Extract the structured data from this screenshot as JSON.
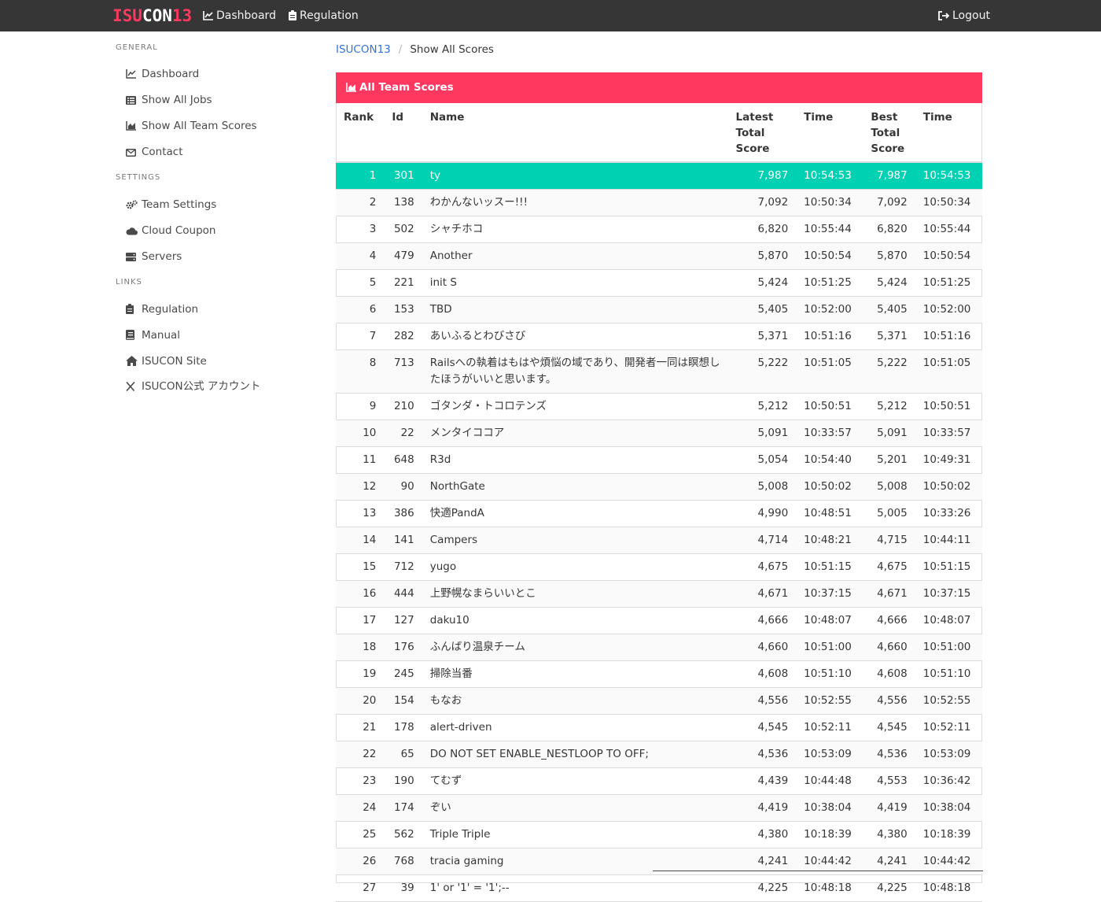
{
  "navbar": {
    "logo_part1": "ISU",
    "logo_part2": "CON",
    "logo_part3": "13",
    "dashboard": "Dashboard",
    "regulation": "Regulation",
    "logout": "Logout"
  },
  "sidebar": {
    "general_label": "GENERAL",
    "settings_label": "SETTINGS",
    "links_label": "LINKS",
    "general": [
      {
        "label": "Dashboard",
        "icon": "chart-line-icon"
      },
      {
        "label": "Show All Jobs",
        "icon": "list-icon"
      },
      {
        "label": "Show All Team Scores",
        "icon": "chart-area-icon"
      },
      {
        "label": "Contact",
        "icon": "envelope-icon"
      }
    ],
    "settings": [
      {
        "label": "Team Settings",
        "icon": "cogs-icon"
      },
      {
        "label": "Cloud Coupon",
        "icon": "cloud-icon"
      },
      {
        "label": "Servers",
        "icon": "server-icon"
      }
    ],
    "links": [
      {
        "label": "Regulation",
        "icon": "clipboard-icon"
      },
      {
        "label": "Manual",
        "icon": "book-icon"
      },
      {
        "label": "ISUCON Site",
        "icon": "home-icon"
      },
      {
        "label": "ISUCON公式 アカウント",
        "icon": "x-logo-icon"
      }
    ]
  },
  "breadcrumb": {
    "root": "ISUCON13",
    "sep": "/",
    "current": "Show All Scores"
  },
  "panel": {
    "title": "All Team Scores",
    "headers": {
      "rank": "Rank",
      "id": "Id",
      "name": "Name",
      "latest_1": "Latest Total",
      "latest_2": "Score",
      "time1": "Time",
      "best_1": "Best Total",
      "best_2": "Score",
      "time2": "Time"
    },
    "rows": [
      {
        "rank": "1",
        "id": "301",
        "name": "ty",
        "latest": "7,987",
        "latest_time": "10:54:53",
        "best": "7,987",
        "best_time": "10:54:53"
      },
      {
        "rank": "2",
        "id": "138",
        "name": "わかんないッスー!!!",
        "latest": "7,092",
        "latest_time": "10:50:34",
        "best": "7,092",
        "best_time": "10:50:34"
      },
      {
        "rank": "3",
        "id": "502",
        "name": "シャチホコ",
        "latest": "6,820",
        "latest_time": "10:55:44",
        "best": "6,820",
        "best_time": "10:55:44"
      },
      {
        "rank": "4",
        "id": "479",
        "name": "Another",
        "latest": "5,870",
        "latest_time": "10:50:54",
        "best": "5,870",
        "best_time": "10:50:54"
      },
      {
        "rank": "5",
        "id": "221",
        "name": "init S",
        "latest": "5,424",
        "latest_time": "10:51:25",
        "best": "5,424",
        "best_time": "10:51:25"
      },
      {
        "rank": "6",
        "id": "153",
        "name": "TBD",
        "latest": "5,405",
        "latest_time": "10:52:00",
        "best": "5,405",
        "best_time": "10:52:00"
      },
      {
        "rank": "7",
        "id": "282",
        "name": "あいふるとわびさび",
        "latest": "5,371",
        "latest_time": "10:51:16",
        "best": "5,371",
        "best_time": "10:51:16"
      },
      {
        "rank": "8",
        "id": "713",
        "name": "Railsへの執着はもはや煩悩の域であり、開発者一同は瞑想したほうがいいと思います。",
        "latest": "5,222",
        "latest_time": "10:51:05",
        "best": "5,222",
        "best_time": "10:51:05"
      },
      {
        "rank": "9",
        "id": "210",
        "name": "ゴタンダ・トコロテンズ",
        "latest": "5,212",
        "latest_time": "10:50:51",
        "best": "5,212",
        "best_time": "10:50:51"
      },
      {
        "rank": "10",
        "id": "22",
        "name": "メンタイココア",
        "latest": "5,091",
        "latest_time": "10:33:57",
        "best": "5,091",
        "best_time": "10:33:57"
      },
      {
        "rank": "11",
        "id": "648",
        "name": "R3d",
        "latest": "5,054",
        "latest_time": "10:54:40",
        "best": "5,201",
        "best_time": "10:49:31"
      },
      {
        "rank": "12",
        "id": "90",
        "name": "NorthGate",
        "latest": "5,008",
        "latest_time": "10:50:02",
        "best": "5,008",
        "best_time": "10:50:02"
      },
      {
        "rank": "13",
        "id": "386",
        "name": "快適PandA",
        "latest": "4,990",
        "latest_time": "10:48:51",
        "best": "5,005",
        "best_time": "10:33:26"
      },
      {
        "rank": "14",
        "id": "141",
        "name": "Campers",
        "latest": "4,714",
        "latest_time": "10:48:21",
        "best": "4,715",
        "best_time": "10:44:11"
      },
      {
        "rank": "15",
        "id": "712",
        "name": "yugo",
        "latest": "4,675",
        "latest_time": "10:51:15",
        "best": "4,675",
        "best_time": "10:51:15"
      },
      {
        "rank": "16",
        "id": "444",
        "name": "上野幌なまらいいとこ",
        "latest": "4,671",
        "latest_time": "10:37:15",
        "best": "4,671",
        "best_time": "10:37:15"
      },
      {
        "rank": "17",
        "id": "127",
        "name": "daku10",
        "latest": "4,666",
        "latest_time": "10:48:07",
        "best": "4,666",
        "best_time": "10:48:07"
      },
      {
        "rank": "18",
        "id": "176",
        "name": "ふんばり温泉チーム",
        "latest": "4,660",
        "latest_time": "10:51:00",
        "best": "4,660",
        "best_time": "10:51:00"
      },
      {
        "rank": "19",
        "id": "245",
        "name": "掃除当番",
        "latest": "4,608",
        "latest_time": "10:51:10",
        "best": "4,608",
        "best_time": "10:51:10"
      },
      {
        "rank": "20",
        "id": "154",
        "name": "もなお",
        "latest": "4,556",
        "latest_time": "10:52:55",
        "best": "4,556",
        "best_time": "10:52:55"
      },
      {
        "rank": "21",
        "id": "178",
        "name": "alert-driven",
        "latest": "4,545",
        "latest_time": "10:52:11",
        "best": "4,545",
        "best_time": "10:52:11"
      },
      {
        "rank": "22",
        "id": "65",
        "name": "DO NOT SET ENABLE_NESTLOOP TO OFF;",
        "latest": "4,536",
        "latest_time": "10:53:09",
        "best": "4,536",
        "best_time": "10:53:09"
      },
      {
        "rank": "23",
        "id": "190",
        "name": "てむず",
        "latest": "4,439",
        "latest_time": "10:44:48",
        "best": "4,553",
        "best_time": "10:36:42"
      },
      {
        "rank": "24",
        "id": "174",
        "name": "ぞい",
        "latest": "4,419",
        "latest_time": "10:38:04",
        "best": "4,419",
        "best_time": "10:38:04"
      },
      {
        "rank": "25",
        "id": "562",
        "name": "Triple Triple",
        "latest": "4,380",
        "latest_time": "10:18:39",
        "best": "4,380",
        "best_time": "10:18:39"
      },
      {
        "rank": "26",
        "id": "768",
        "name": "tracia gaming",
        "latest": "4,241",
        "latest_time": "10:44:42",
        "best": "4,241",
        "best_time": "10:44:42"
      },
      {
        "rank": "27",
        "id": "39",
        "name": "1' or '1' = '1';--",
        "latest": "4,225",
        "latest_time": "10:48:18",
        "best": "4,225",
        "best_time": "10:48:18"
      }
    ]
  },
  "colors": {
    "navbar": "#363636",
    "accent": "#ff3860",
    "highlight_row": "#00d1b2",
    "link": "#3273dc"
  }
}
